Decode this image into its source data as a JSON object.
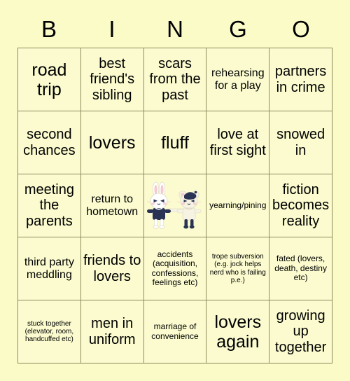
{
  "header": {
    "letters": [
      "B",
      "I",
      "N",
      "G",
      "O"
    ]
  },
  "colors": {
    "page_background": "#fbfbc8",
    "cell_background": "#fbfbcf",
    "grid_line": "#8a8a5c",
    "text": "#000000",
    "mascot_navy": "#2b3354",
    "mascot_cream": "#f7f3e2",
    "mascot_pink": "#f5c9ce"
  },
  "grid": {
    "rows": [
      [
        {
          "text": "road trip",
          "size": "xl"
        },
        {
          "text": "best friend's sibling",
          "size": "lg"
        },
        {
          "text": "scars from the past",
          "size": "lg"
        },
        {
          "text": "rehearsing for a play",
          "size": "md"
        },
        {
          "text": "partners in crime",
          "size": "lg"
        }
      ],
      [
        {
          "text": "second chances",
          "size": "lg"
        },
        {
          "text": "lovers",
          "size": "xl"
        },
        {
          "text": "fluff",
          "size": "xl"
        },
        {
          "text": "love at first sight",
          "size": "lg"
        },
        {
          "text": "snowed in",
          "size": "lg"
        }
      ],
      [
        {
          "text": "meeting the parents",
          "size": "lg"
        },
        {
          "text": "return to hometown",
          "size": "md"
        },
        {
          "text": "",
          "size": "free",
          "icon": "couple-mascots-image"
        },
        {
          "text": "yearning/pining",
          "size": "sm"
        },
        {
          "text": "fiction becomes reality",
          "size": "lg"
        }
      ],
      [
        {
          "text": "third party meddling",
          "size": "md"
        },
        {
          "text": "friends to lovers",
          "size": "lg"
        },
        {
          "text": "accidents (acquisition, confessions, feelings etc)",
          "size": "sm"
        },
        {
          "text": "trope subversion (e.g. jock helps nerd who is failing p.e.)",
          "size": "xs"
        },
        {
          "text": "fated (lovers, death, destiny etc)",
          "size": "sm"
        }
      ],
      [
        {
          "text": "stuck together (elevator, room, handcuffed etc)",
          "size": "xs"
        },
        {
          "text": "men in uniform",
          "size": "lg"
        },
        {
          "text": "marriage of convenience",
          "size": "sm"
        },
        {
          "text": "lovers again",
          "size": "xl"
        },
        {
          "text": "growing up together",
          "size": "lg"
        }
      ]
    ]
  }
}
